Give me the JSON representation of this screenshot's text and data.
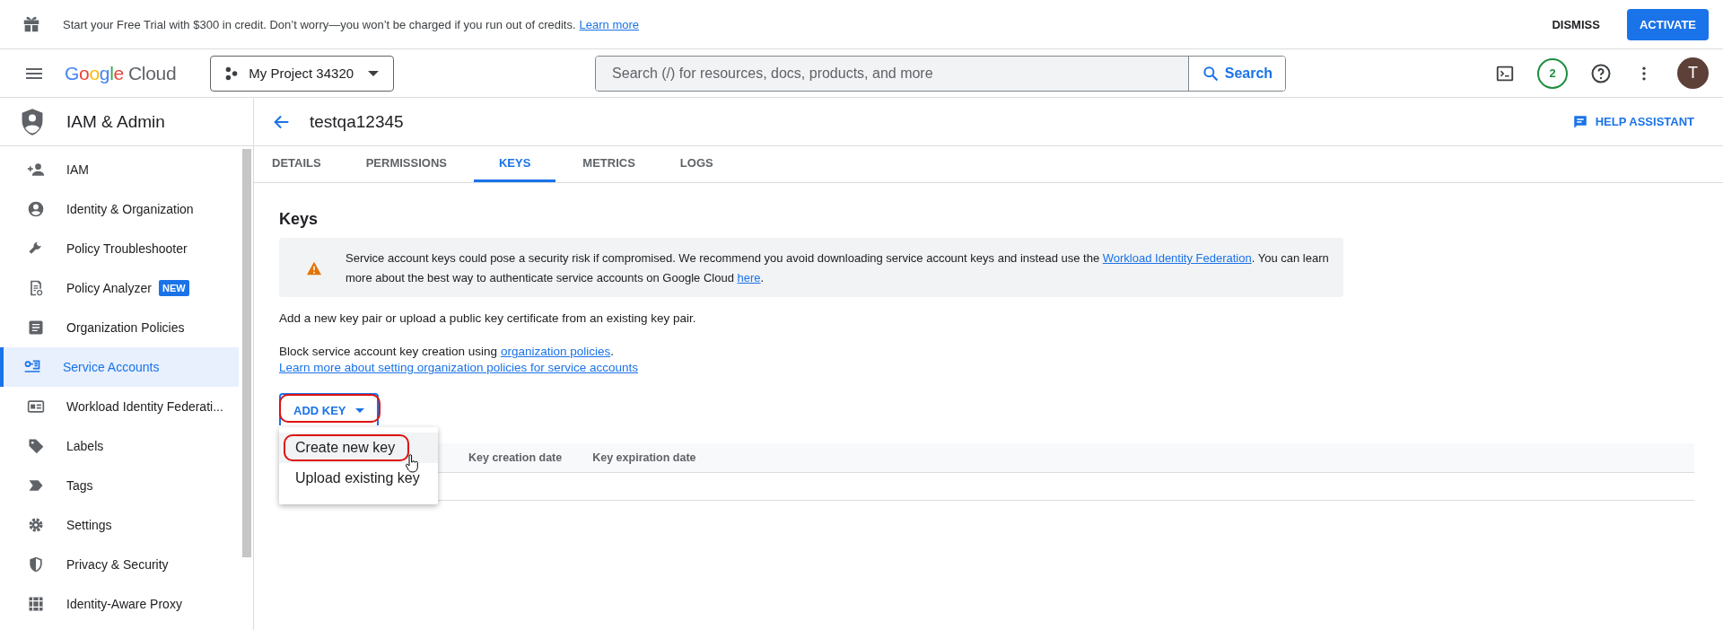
{
  "banner": {
    "message": "Start your Free Trial with $300 in credit. Don’t worry—you won’t be charged if you run out of credits.",
    "link": "Learn more",
    "dismiss": "DISMISS",
    "activate": "ACTIVATE"
  },
  "header": {
    "logo": {
      "brand": "Google",
      "product": "Cloud"
    },
    "project": "My Project 34320",
    "search": {
      "placeholder": "Search (/) for resources, docs, products, and more",
      "button": "Search"
    },
    "notifications": "2",
    "avatar": "T"
  },
  "sidebar": {
    "title": "IAM & Admin",
    "items": [
      {
        "label": "IAM",
        "selected": false
      },
      {
        "label": "Identity & Organization",
        "selected": false
      },
      {
        "label": "Policy Troubleshooter",
        "selected": false
      },
      {
        "label": "Policy Analyzer",
        "badge": "NEW",
        "selected": false
      },
      {
        "label": "Organization Policies",
        "selected": false
      },
      {
        "label": "Service Accounts",
        "selected": true
      },
      {
        "label": "Workload Identity Federati...",
        "selected": false
      },
      {
        "label": "Labels",
        "selected": false
      },
      {
        "label": "Tags",
        "selected": false
      },
      {
        "label": "Settings",
        "selected": false
      },
      {
        "label": "Privacy & Security",
        "selected": false
      },
      {
        "label": "Identity-Aware Proxy",
        "selected": false
      }
    ]
  },
  "page": {
    "title": "testqa12345",
    "help": "HELP ASSISTANT",
    "tabs": [
      {
        "label": "DETAILS",
        "selected": false
      },
      {
        "label": "PERMISSIONS",
        "selected": false
      },
      {
        "label": "KEYS",
        "selected": true
      },
      {
        "label": "METRICS",
        "selected": false
      },
      {
        "label": "LOGS",
        "selected": false
      }
    ],
    "heading": "Keys",
    "warning": [
      {
        "kind": "text",
        "text": "Service account keys could pose a security risk if compromised. We recommend you avoid downloading service account keys and instead use the "
      },
      {
        "kind": "link",
        "text": "Workload Identity Federation"
      },
      {
        "kind": "text",
        "text": ". You can learn more about the best way to authenticate service accounts on Google Cloud "
      },
      {
        "kind": "link",
        "text": "here"
      },
      {
        "kind": "text",
        "text": "."
      }
    ],
    "intro": "Add a new key pair or upload a public key certificate from an existing key pair.",
    "block": [
      {
        "kind": "text",
        "text": "Block service account key creation using "
      },
      {
        "kind": "link",
        "text": "organization policies"
      },
      {
        "kind": "text",
        "text": "."
      }
    ],
    "learn_more": "Learn more about setting organization policies for service accounts",
    "add_key": {
      "label": "ADD KEY",
      "highlighted": true
    },
    "menu": [
      {
        "label": "Create new key",
        "highlighted": true
      },
      {
        "label": "Upload existing key",
        "highlighted": false
      }
    ],
    "table": {
      "columns": [
        "Key creation date",
        "Key expiration date"
      ]
    }
  }
}
